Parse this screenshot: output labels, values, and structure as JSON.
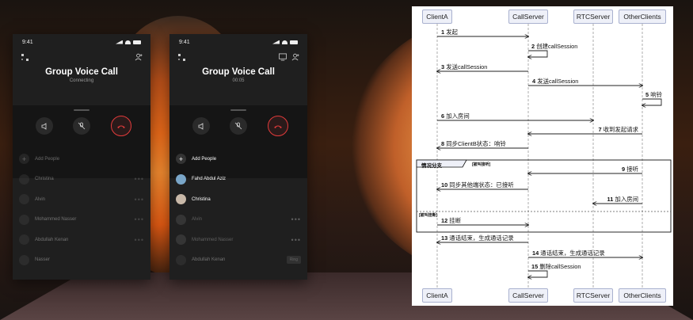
{
  "phones": [
    {
      "time": "9:41",
      "title": "Group Voice Call",
      "subtitle": "Connecting",
      "add_people": "Add People",
      "participants": [
        {
          "name": "Christina",
          "action": "more"
        },
        {
          "name": "Alvin",
          "action": "more"
        },
        {
          "name": "Mohammed Nasser",
          "action": "more"
        },
        {
          "name": "Abdullah Kenan",
          "action": "more"
        },
        {
          "name": "Nasser",
          "action": ""
        }
      ]
    },
    {
      "time": "9:41",
      "title": "Group Voice Call",
      "subtitle": "00:05",
      "add_people": "Add People",
      "participants": [
        {
          "name": "Fahd Abdul Aziz",
          "action": ""
        },
        {
          "name": "Christina",
          "action": ""
        },
        {
          "name": "Alvin",
          "action": "more"
        },
        {
          "name": "Mohammed Nasser",
          "action": "more"
        },
        {
          "name": "Abdullah Kenan",
          "action": "ring"
        }
      ],
      "ring_label": "Ring"
    }
  ],
  "diagram": {
    "actors": [
      "ClientA",
      "CallServer",
      "RTCServer",
      "OtherClients"
    ],
    "messages": [
      {
        "n": "1",
        "text": "发起",
        "from": 0,
        "to": 1
      },
      {
        "n": "2",
        "text": "创建callSession",
        "from": 1,
        "to": 1
      },
      {
        "n": "3",
        "text": "发送callSession",
        "from": 1,
        "to": 0
      },
      {
        "n": "4",
        "text": "发送callSession",
        "from": 1,
        "to": 3
      },
      {
        "n": "5",
        "text": "响铃",
        "from": 3,
        "to": 3
      },
      {
        "n": "6",
        "text": "加入房间",
        "from": 0,
        "to": 2
      },
      {
        "n": "7",
        "text": "收到发起请求",
        "from": 3,
        "to": 1
      },
      {
        "n": "8",
        "text": "同步ClientB状态：响铃",
        "from": 1,
        "to": 0
      },
      {
        "n": "9",
        "text": "接听",
        "from": 3,
        "to": 1
      },
      {
        "n": "10",
        "text": "同步其他端状态：已接听",
        "from": 1,
        "to": 0
      },
      {
        "n": "11",
        "text": "加入房间",
        "from": 3,
        "to": 2
      },
      {
        "n": "12",
        "text": "挂断",
        "from": 0,
        "to": 1
      },
      {
        "n": "13",
        "text": "通话结束，生成通话记录",
        "from": 1,
        "to": 0
      },
      {
        "n": "14",
        "text": "通话结束，生成通话记录",
        "from": 1,
        "to": 3
      },
      {
        "n": "15",
        "text": "删除callSession",
        "from": 1,
        "to": 1
      }
    ],
    "alt": {
      "title": "情况分支",
      "guard1": "[被叫接听]",
      "guard2": "[被叫挂断]"
    }
  },
  "colors": {
    "end_call": "#e23b3b",
    "actor_fill": "#eef0f8",
    "actor_border": "#a9b1cf"
  }
}
